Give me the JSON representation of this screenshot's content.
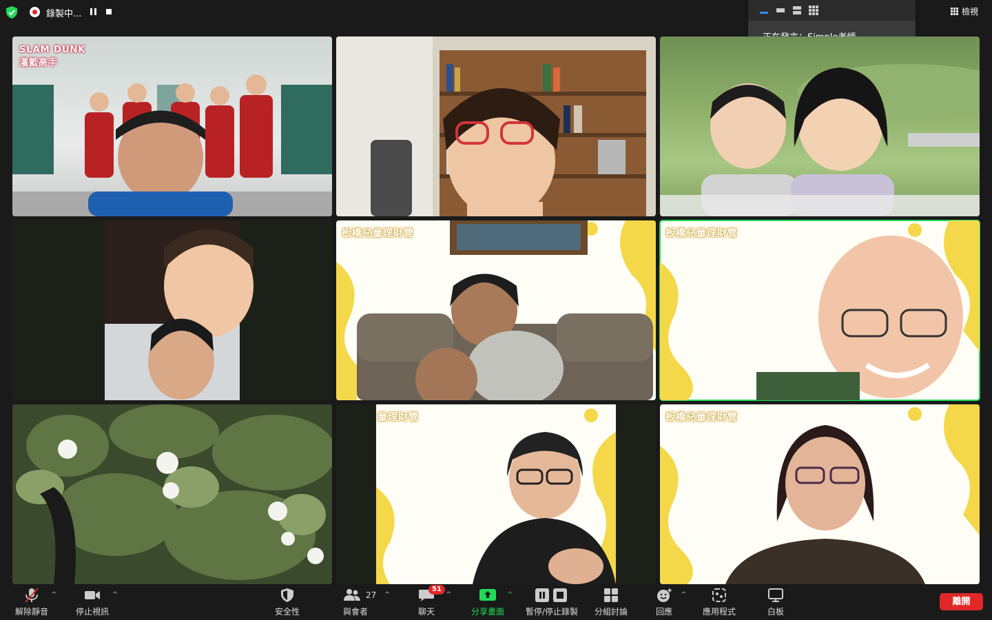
{
  "top_bar": {
    "recording_label": "錄製中...",
    "view_label": "檢視"
  },
  "speaker_popup": {
    "speaking_text": "正在發言：Simple老師"
  },
  "tiles": [
    {
      "id": "p1",
      "kind": "participant",
      "overlay": "SLAM DUNK 灌籃高手",
      "background": "anime-banner"
    },
    {
      "id": "p2",
      "kind": "participant",
      "overlay": "",
      "background": "bookshelf"
    },
    {
      "id": "p3",
      "kind": "participant",
      "overlay": "",
      "background": "green-hills"
    },
    {
      "id": "p4",
      "kind": "participant",
      "overlay": "",
      "background": "bedroom"
    },
    {
      "id": "p5",
      "kind": "participant",
      "overlay": "板橋兒童理財營",
      "background": "yellow-theme"
    },
    {
      "id": "p6",
      "kind": "participant",
      "overlay": "板橋兒童理財營",
      "background": "yellow-theme",
      "active_speaker": true
    },
    {
      "id": "p7",
      "kind": "participant",
      "overlay": "",
      "background": "plants"
    },
    {
      "id": "p8",
      "kind": "participant",
      "overlay": "童理財營",
      "background": "yellow-theme"
    },
    {
      "id": "p9",
      "kind": "participant",
      "overlay": "板橋兒童理財營",
      "background": "yellow-theme"
    }
  ],
  "toolbar": {
    "unmute": "解除靜音",
    "stop_video": "停止視訊",
    "security": "安全性",
    "participants": "與會者",
    "participants_count": "27",
    "chat": "聊天",
    "chat_badge": "51",
    "share_screen": "分享畫面",
    "pause_stop_recording": "暫停/停止錄製",
    "breakout": "分組討論",
    "reactions": "回應",
    "apps": "應用程式",
    "whiteboard": "白板",
    "leave": "離開"
  },
  "colors": {
    "active_speaker_border": "#23d959",
    "leave_button": "#e02828",
    "share_green": "#23d959",
    "recording_red": "#e02828",
    "theme_yellow": "#f5d84a"
  }
}
